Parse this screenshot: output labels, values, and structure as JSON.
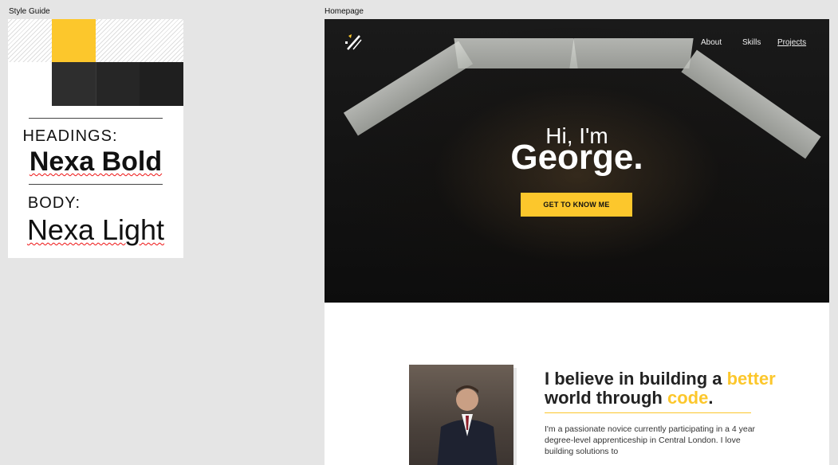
{
  "labels": {
    "style_guide": "Style Guide",
    "homepage": "Homepage"
  },
  "style_guide": {
    "headings_label": "HEADINGS:",
    "headings_font": "Nexa Bold",
    "body_label": "BODY:",
    "body_font": "Nexa Light",
    "colors": [
      "#fcc72c",
      "#2e2e2e",
      "#262626",
      "#1f1f1f"
    ]
  },
  "nav": {
    "links": [
      "About",
      "Skills",
      "Projects"
    ]
  },
  "hero": {
    "greeting": "Hi, I'm",
    "name": "George.",
    "cta_label": "GET TO KNOW ME"
  },
  "about": {
    "title_part1": "I believe in building a ",
    "title_highlight1": "better",
    "title_part2": " world through ",
    "title_highlight2": "code",
    "title_end": ".",
    "body": "I'm a passionate novice currently participating in a 4 year degree-level apprenticeship in Central London. I love building solutions to"
  },
  "accent": "#fcc72c"
}
